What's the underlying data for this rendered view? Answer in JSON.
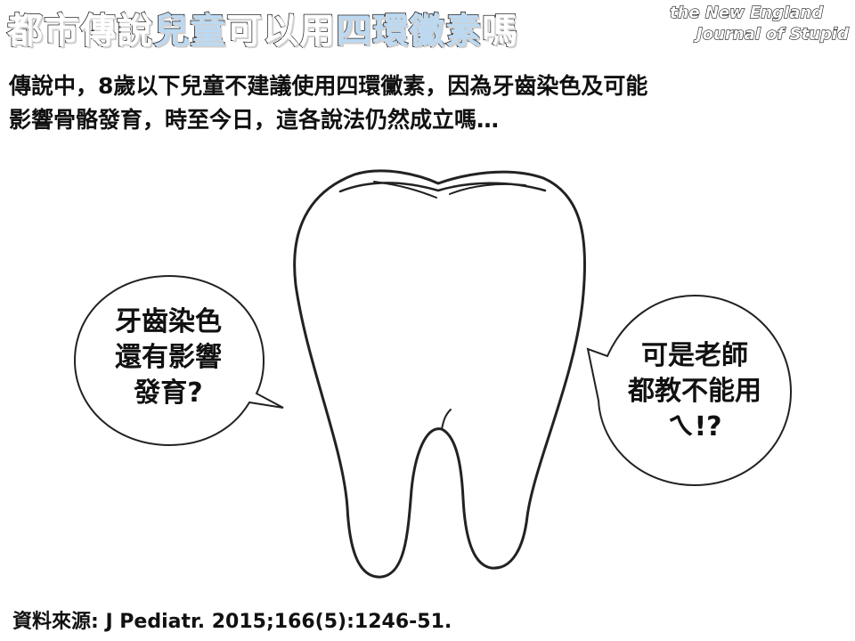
{
  "header": {
    "title_part1": "都市傳說",
    "title_part2": "兒童",
    "title_part3": "可以用",
    "title_part4": "四環黴素",
    "title_part5": "嗎",
    "logo_line1": "the New England",
    "logo_line2": "Journal of Stupid"
  },
  "intro": {
    "line1": "傳說中，8歲以下兒童不建議使用四環黴素，因為牙齒染色及可能",
    "line2": "影響骨骼發育，時至今日，這各說法仍然成立嗎…"
  },
  "bubbles": {
    "left": {
      "line1": "牙齒染色",
      "line2": "還有影響",
      "line3": "發育?"
    },
    "right": {
      "line1": "可是老師",
      "line2": "都教不能用",
      "line3": "ㄟ!?"
    }
  },
  "footer": {
    "source": "資料來源: J Pediatr. 2015;166(5):1246-51."
  },
  "colors": {
    "title_highlight": "#bcd9f2",
    "outline": "#222222"
  }
}
